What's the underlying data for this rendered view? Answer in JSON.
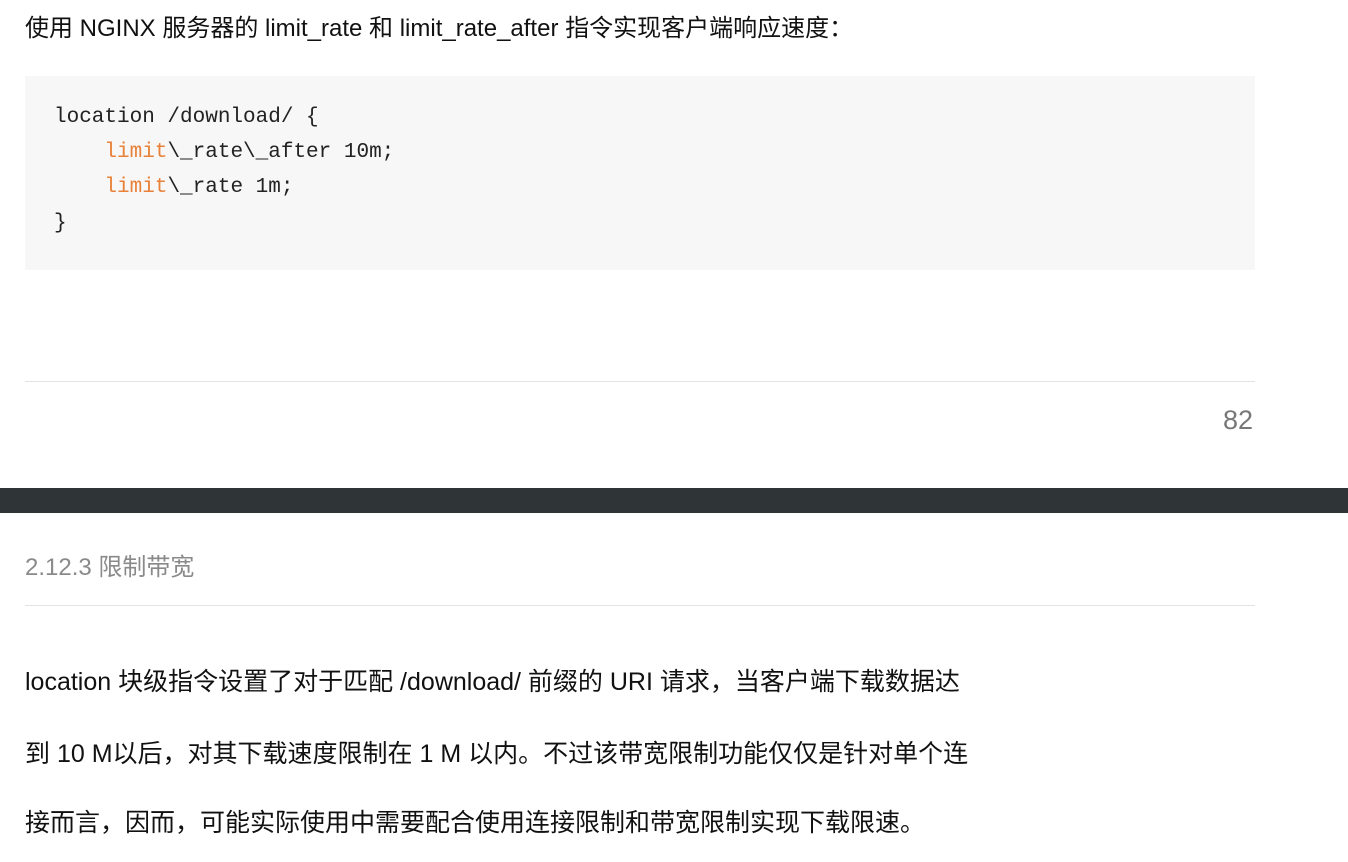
{
  "intro": {
    "text": "使用 NGINX 服务器的 limit_rate 和 limit_rate_after 指令实现客户端响应速度："
  },
  "code": {
    "line1": "location /download/ {",
    "line2_indent": "    ",
    "line2_keyword": "limit",
    "line2_rest": "\\_rate\\_after 10m;",
    "line3_indent": "    ",
    "line3_keyword": "limit",
    "line3_rest": "\\_rate 1m;",
    "line4": "}"
  },
  "page_number": "82",
  "section": {
    "heading": "2.12.3 限制带宽"
  },
  "paragraph": {
    "line1": "location 块级指令设置了对于匹配 /download/ 前缀的 URI 请求，当客户端下载数据达",
    "line2": "到 10 M以后，对其下载速度限制在 1 M 以内。不过该带宽限制功能仅仅是针对单个连",
    "line3": "接而言，因而，可能实际使用中需要配合使用连接限制和带宽限制实现下载限速。"
  }
}
